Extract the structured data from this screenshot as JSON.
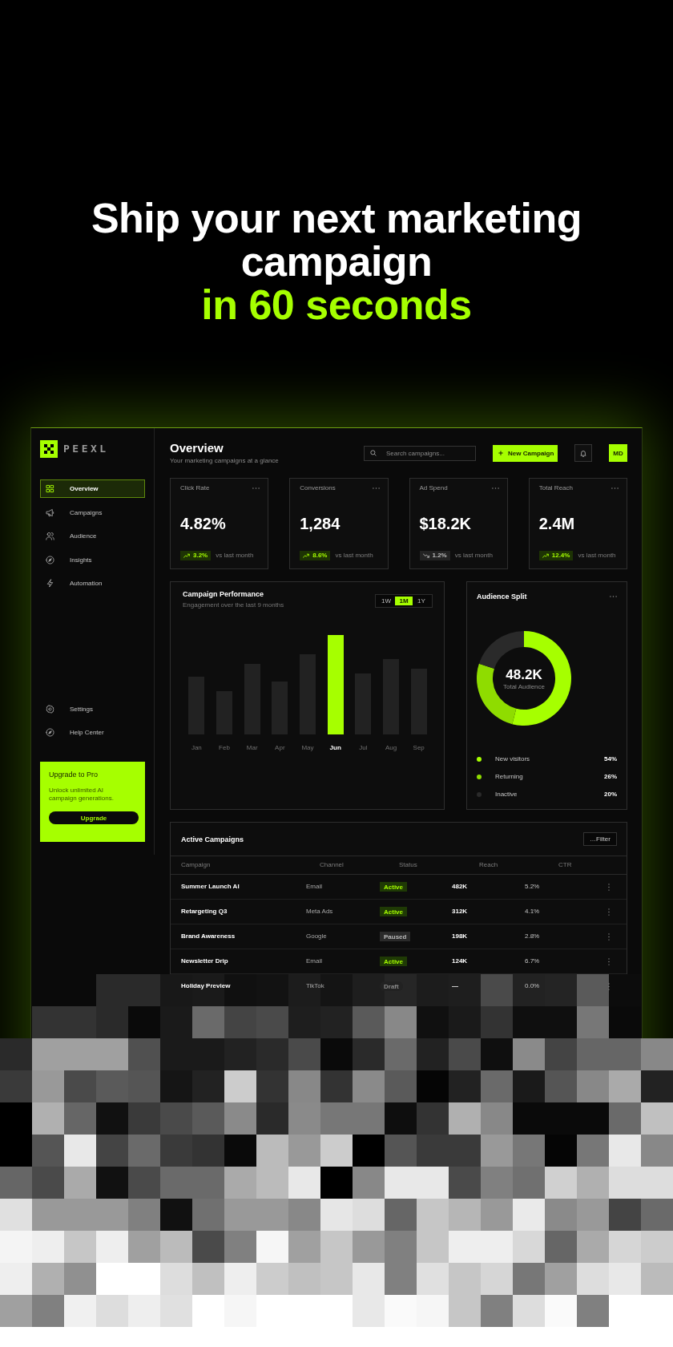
{
  "headline": {
    "text": "Ship your next marketing campaign",
    "accent": "in 60 seconds"
  },
  "sidebar": {
    "logo": "PEEXL",
    "items": [
      {
        "label": "Overview",
        "selected": true
      },
      {
        "label": "Campaigns",
        "selected": false
      },
      {
        "label": "Audience",
        "selected": false
      },
      {
        "label": "Insights",
        "selected": false
      },
      {
        "label": "Automation",
        "selected": false
      }
    ],
    "footer_items": [
      {
        "label": "Settings",
        "selected": false
      },
      {
        "label": "Help Center",
        "selected": false
      }
    ],
    "upgrade": {
      "title": "Upgrade to Pro",
      "text": "Unlock unlimited AI campaign generations.",
      "button": "Upgrade"
    }
  },
  "header": {
    "title": "Overview",
    "subtitle": "Your marketing campaigns at a glance",
    "search": {
      "placeholder": "Search campaigns..."
    },
    "new_button": "New Campaign",
    "avatar": "MD"
  },
  "stats": [
    {
      "label": "Click Rate",
      "value": "4.82%",
      "change": "3.2%",
      "rising": true,
      "note": "vs last month"
    },
    {
      "label": "Conversions",
      "value": "1,284",
      "change": "8.6%",
      "rising": true,
      "note": "vs last month"
    },
    {
      "label": "Ad Spend",
      "value": "$18.2K",
      "change": "1.2%",
      "rising": false,
      "note": "vs last month"
    },
    {
      "label": "Total Reach",
      "value": "2.4M",
      "change": "12.4%",
      "rising": true,
      "note": "vs last month"
    }
  ],
  "performance": {
    "title": "Campaign Performance",
    "subtitle": "Engagement over the last 9 months",
    "ranges": [
      {
        "label": "1W",
        "selected": false
      },
      {
        "label": "1M",
        "selected": true
      },
      {
        "label": "1Y",
        "selected": false
      }
    ],
    "months": [
      {
        "label": "Jan",
        "selected": false
      },
      {
        "label": "Feb",
        "selected": false
      },
      {
        "label": "Mar",
        "selected": false
      },
      {
        "label": "Apr",
        "selected": false
      },
      {
        "label": "May",
        "selected": false
      },
      {
        "label": "Jun",
        "selected": true
      },
      {
        "label": "Jul",
        "selected": false
      },
      {
        "label": "Aug",
        "selected": false
      },
      {
        "label": "Sep",
        "selected": false
      }
    ]
  },
  "audience": {
    "title": "Audience Split",
    "total": "48.2K",
    "total_label": "Total Audience",
    "legend": [
      {
        "value": "54%",
        "color": "#a6ff00"
      },
      {
        "value": "26%",
        "color": "#8fdc00"
      },
      {
        "value": "20%",
        "color": "#2a2a2a"
      }
    ],
    "chart_data": {
      "type": "donut",
      "categories": [
        "New visitors",
        "Returning",
        "Inactive"
      ],
      "values": [
        54,
        26,
        20
      ]
    }
  },
  "campaigns": {
    "title": "Active Campaigns",
    "filter_button": "…Filter",
    "columns": [
      "Campaign",
      "Channel",
      "Status",
      "Reach",
      "CTR"
    ],
    "rows": [
      {
        "name": "Summer Launch AI",
        "channel": "Email",
        "status": {
          "label": "Active",
          "kind": "active"
        },
        "reach": "482K",
        "ctr": "5.2%"
      },
      {
        "name": "Retargeting Q3",
        "channel": "Meta Ads",
        "status": {
          "label": "Active",
          "kind": "active"
        },
        "reach": "312K",
        "ctr": "4.1%"
      },
      {
        "name": "Brand Awareness",
        "channel": "Google",
        "status": {
          "label": "Paused",
          "kind": "paused"
        },
        "reach": "198K",
        "ctr": "2.8%"
      },
      {
        "name": "Newsletter Drip",
        "channel": "Email",
        "status": {
          "label": "Active",
          "kind": "active"
        },
        "reach": "124K",
        "ctr": "6.7%"
      },
      {
        "name": "Holiday Preview",
        "channel": "TikTok",
        "status": {
          "label": "Draft",
          "kind": "draft"
        },
        "reach": "—",
        "ctr": "0.0%"
      }
    ]
  }
}
